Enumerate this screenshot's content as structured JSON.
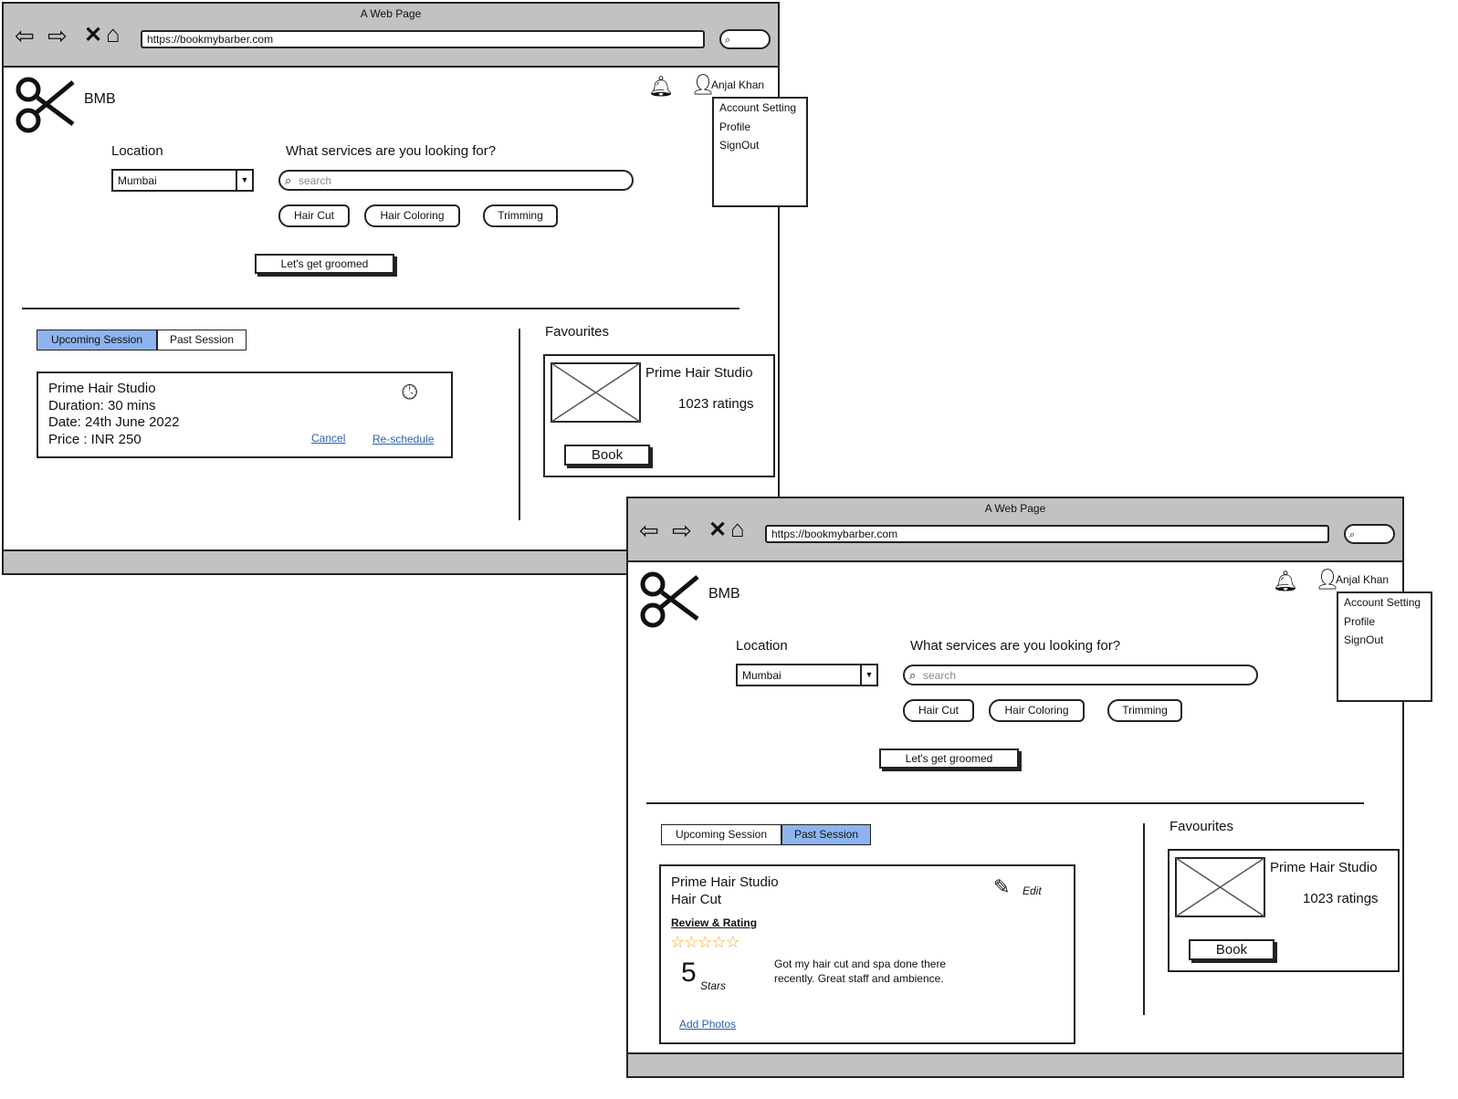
{
  "windows": [
    {
      "title": "A Web Page",
      "url": "https://bookmybarber.com",
      "brand": "BMB",
      "user": "Anjal Khan",
      "user_menu": [
        "Account Setting",
        "Profile",
        "SignOut"
      ],
      "location_label": "Location",
      "location_value": "Mumbai",
      "services_label": "What services are you looking for?",
      "search_placeholder": "search",
      "chips": [
        "Hair Cut",
        "Hair Coloring",
        "Trimming"
      ],
      "cta": "Let's get groomed",
      "tabs": [
        "Upcoming Session",
        "Past Session"
      ],
      "active_tab": 0,
      "session": {
        "lines": [
          "Prime Hair Studio",
          "Duration: 30 mins",
          "Date: 24th June 2022",
          "Price : INR 250"
        ],
        "cancel": "Cancel",
        "reschedule": "Re-schedule"
      },
      "favourites_label": "Favourites",
      "fav": {
        "name": "Prime Hair Studio",
        "ratings": "1023 ratings",
        "book": "Book"
      }
    },
    {
      "title": "A Web Page",
      "url": "https://bookmybarber.com",
      "brand": "BMB",
      "user": "Anjal Khan",
      "user_menu": [
        "Account Setting",
        "Profile",
        "SignOut"
      ],
      "location_label": "Location",
      "location_value": "Mumbai",
      "services_label": "What services are you looking for?",
      "search_placeholder": "search",
      "chips": [
        "Hair Cut",
        "Hair Coloring",
        "Trimming"
      ],
      "cta": "Let's get groomed",
      "tabs": [
        "Upcoming Session",
        "Past Session"
      ],
      "active_tab": 1,
      "past": {
        "studio": "Prime Hair Studio",
        "service": "Hair Cut",
        "review_heading": "Review & Rating",
        "rating": 5,
        "rating_max": 5,
        "rating_value": "5",
        "rating_unit": "Stars",
        "review": "Got my hair cut and spa done there recently. Great staff and ambience.",
        "edit": "Edit",
        "add_photos": "Add Photos"
      },
      "favourites_label": "Favourites",
      "fav": {
        "name": "Prime Hair Studio",
        "ratings": "1023 ratings",
        "book": "Book"
      }
    }
  ],
  "colors": {
    "active_tab": "#8eb4ef",
    "link": "#2a5fae",
    "star": "#f5a623",
    "chrome": "#c2c2c2"
  }
}
